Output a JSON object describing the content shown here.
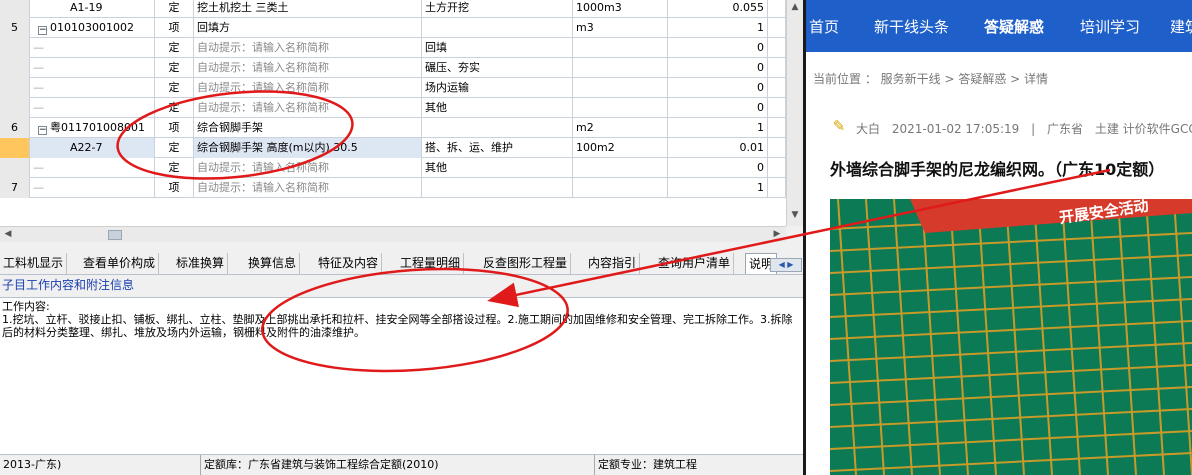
{
  "grid": {
    "rows": [
      {
        "num": "",
        "code": "A1-19",
        "kind": "定",
        "name": "挖土机挖土 三类土",
        "feature": "土方开挖",
        "unit": "1000m3",
        "qty": "0.055",
        "type": "sub"
      },
      {
        "num": "5",
        "code": "010103001002",
        "kind": "项",
        "name": "回填方",
        "feature": "",
        "unit": "m3",
        "qty": "1",
        "type": "item"
      },
      {
        "num": "",
        "code": "",
        "kind": "定",
        "name": "自动提示：请输入名称简称",
        "feature": "回填",
        "unit": "",
        "qty": "0",
        "type": "hint"
      },
      {
        "num": "",
        "code": "",
        "kind": "定",
        "name": "自动提示：请输入名称简称",
        "feature": "碾压、夯实",
        "unit": "",
        "qty": "0",
        "type": "hint"
      },
      {
        "num": "",
        "code": "",
        "kind": "定",
        "name": "自动提示：请输入名称简称",
        "feature": "场内运输",
        "unit": "",
        "qty": "0",
        "type": "hint"
      },
      {
        "num": "",
        "code": "",
        "kind": "定",
        "name": "自动提示：请输入名称简称",
        "feature": "其他",
        "unit": "",
        "qty": "0",
        "type": "hint"
      },
      {
        "num": "6",
        "code": "粤011701008001",
        "kind": "项",
        "name": "综合钢脚手架",
        "feature": "",
        "unit": "m2",
        "qty": "1",
        "type": "item"
      },
      {
        "num": "",
        "code": "A22-7",
        "kind": "定",
        "name": "综合钢脚手架 高度(m以内) 30.5",
        "feature": "搭、拆、运、维护",
        "unit": "100m2",
        "qty": "0.01",
        "type": "sel"
      },
      {
        "num": "",
        "code": "",
        "kind": "定",
        "name": "自动提示：请输入名称简称",
        "feature": "其他",
        "unit": "",
        "qty": "0",
        "type": "hint"
      },
      {
        "num": "7",
        "code": "",
        "kind": "项",
        "name": "自动提示：请输入名称简称",
        "feature": "",
        "unit": "",
        "qty": "1",
        "type": "hintitem"
      }
    ]
  },
  "tabs": [
    "工料机显示",
    "查看单价构成",
    "标准换算",
    "换算信息",
    "特征及内容",
    "工程量明细",
    "反查图形工程量",
    "内容指引",
    "查询用户清单",
    "说明"
  ],
  "active_tab": "说明",
  "subtitle": "子目工作内容和附注信息",
  "content": {
    "label": "工作内容:",
    "text": "1.挖坑、立杆、驳接止扣、铺板、绑扎、立柱、垫脚及上部挑出承托和拉杆、挂安全网等全部搭设过程。2.施工期间的加固维修和安全管理、完工拆除工作。3.拆除后的材料分类整理、绑扎、堆放及场内外运输，钢栅料及附件的油漆维护。"
  },
  "status": {
    "left": "2013-广东)",
    "quota_lib": "定额库：广东省建筑与装饰工程综合定额(2010)",
    "quota_major": "定额专业：建筑工程"
  },
  "web": {
    "nav": [
      "首页",
      "新干线头条",
      "答疑解惑",
      "培训学习",
      "建筑"
    ],
    "nav_active": "答疑解惑",
    "crumb": "当前位置 ： 服务新干线 > 答疑解惑 > 详情",
    "author": "大白",
    "datetime": "2021-01-02 17:05:19",
    "separator": "|",
    "region": "广东省",
    "category": "土建 计价软件GCCP",
    "title": "外墙综合脚手架的尼龙编织网。（广东10定额）",
    "photo_banner": "开展安全活动"
  },
  "colors": {
    "nav_bg": "#1e5fc9",
    "annotation": "#e01a1a",
    "net": "#0c7f5a",
    "scaffold": "#c89a2a"
  }
}
